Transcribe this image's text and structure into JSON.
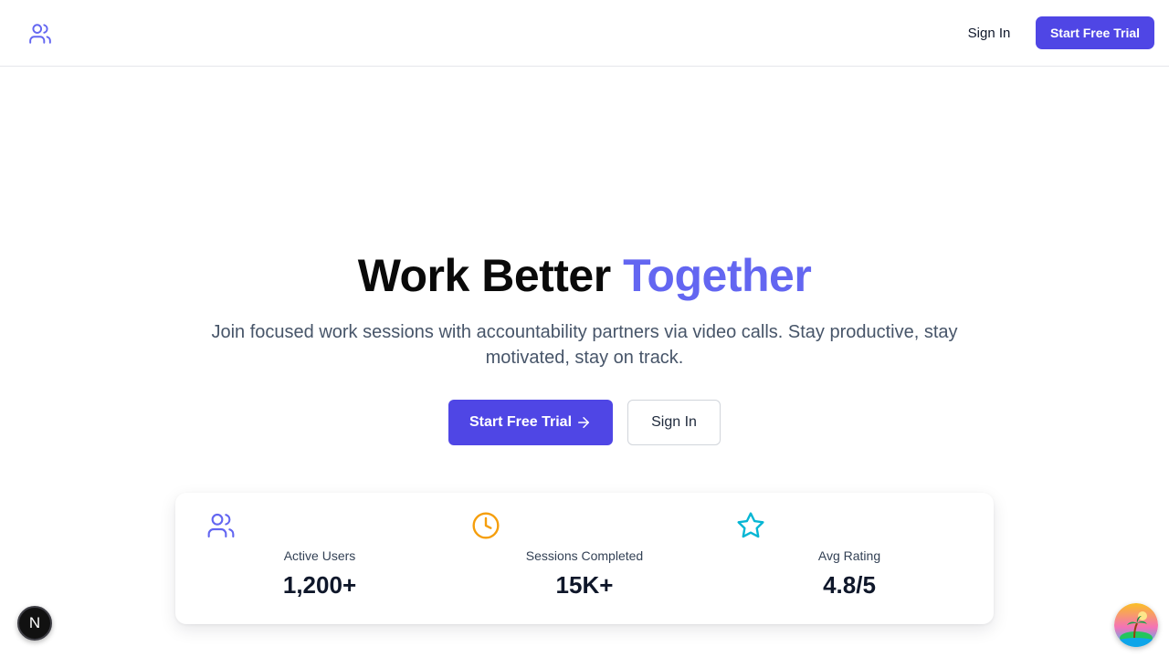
{
  "header": {
    "logo_icon": "users-icon",
    "signin_label": "Sign In",
    "trial_label": "Start Free Trial"
  },
  "hero": {
    "title_main": "Work Better ",
    "title_accent": "Together",
    "subtitle": "Join focused work sessions with accountability partners via video calls. Stay productive, stay motivated, stay on track.",
    "cta_trial_label": "Start Free Trial",
    "cta_signin_label": "Sign In"
  },
  "stats": [
    {
      "icon": "users-icon",
      "label": "Active Users",
      "value": "1,200+",
      "color": "#6366f1"
    },
    {
      "icon": "clock-icon",
      "label": "Sessions Completed",
      "value": "15K+",
      "color": "#f59e0b"
    },
    {
      "icon": "star-icon",
      "label": "Avg Rating",
      "value": "4.8/5",
      "color": "#06b6d4"
    }
  ],
  "badges": {
    "dev_badge_letter": "N",
    "assistant_icon": "island-icon"
  },
  "colors": {
    "primary": "#4f46e5",
    "accent": "#6366f1"
  }
}
